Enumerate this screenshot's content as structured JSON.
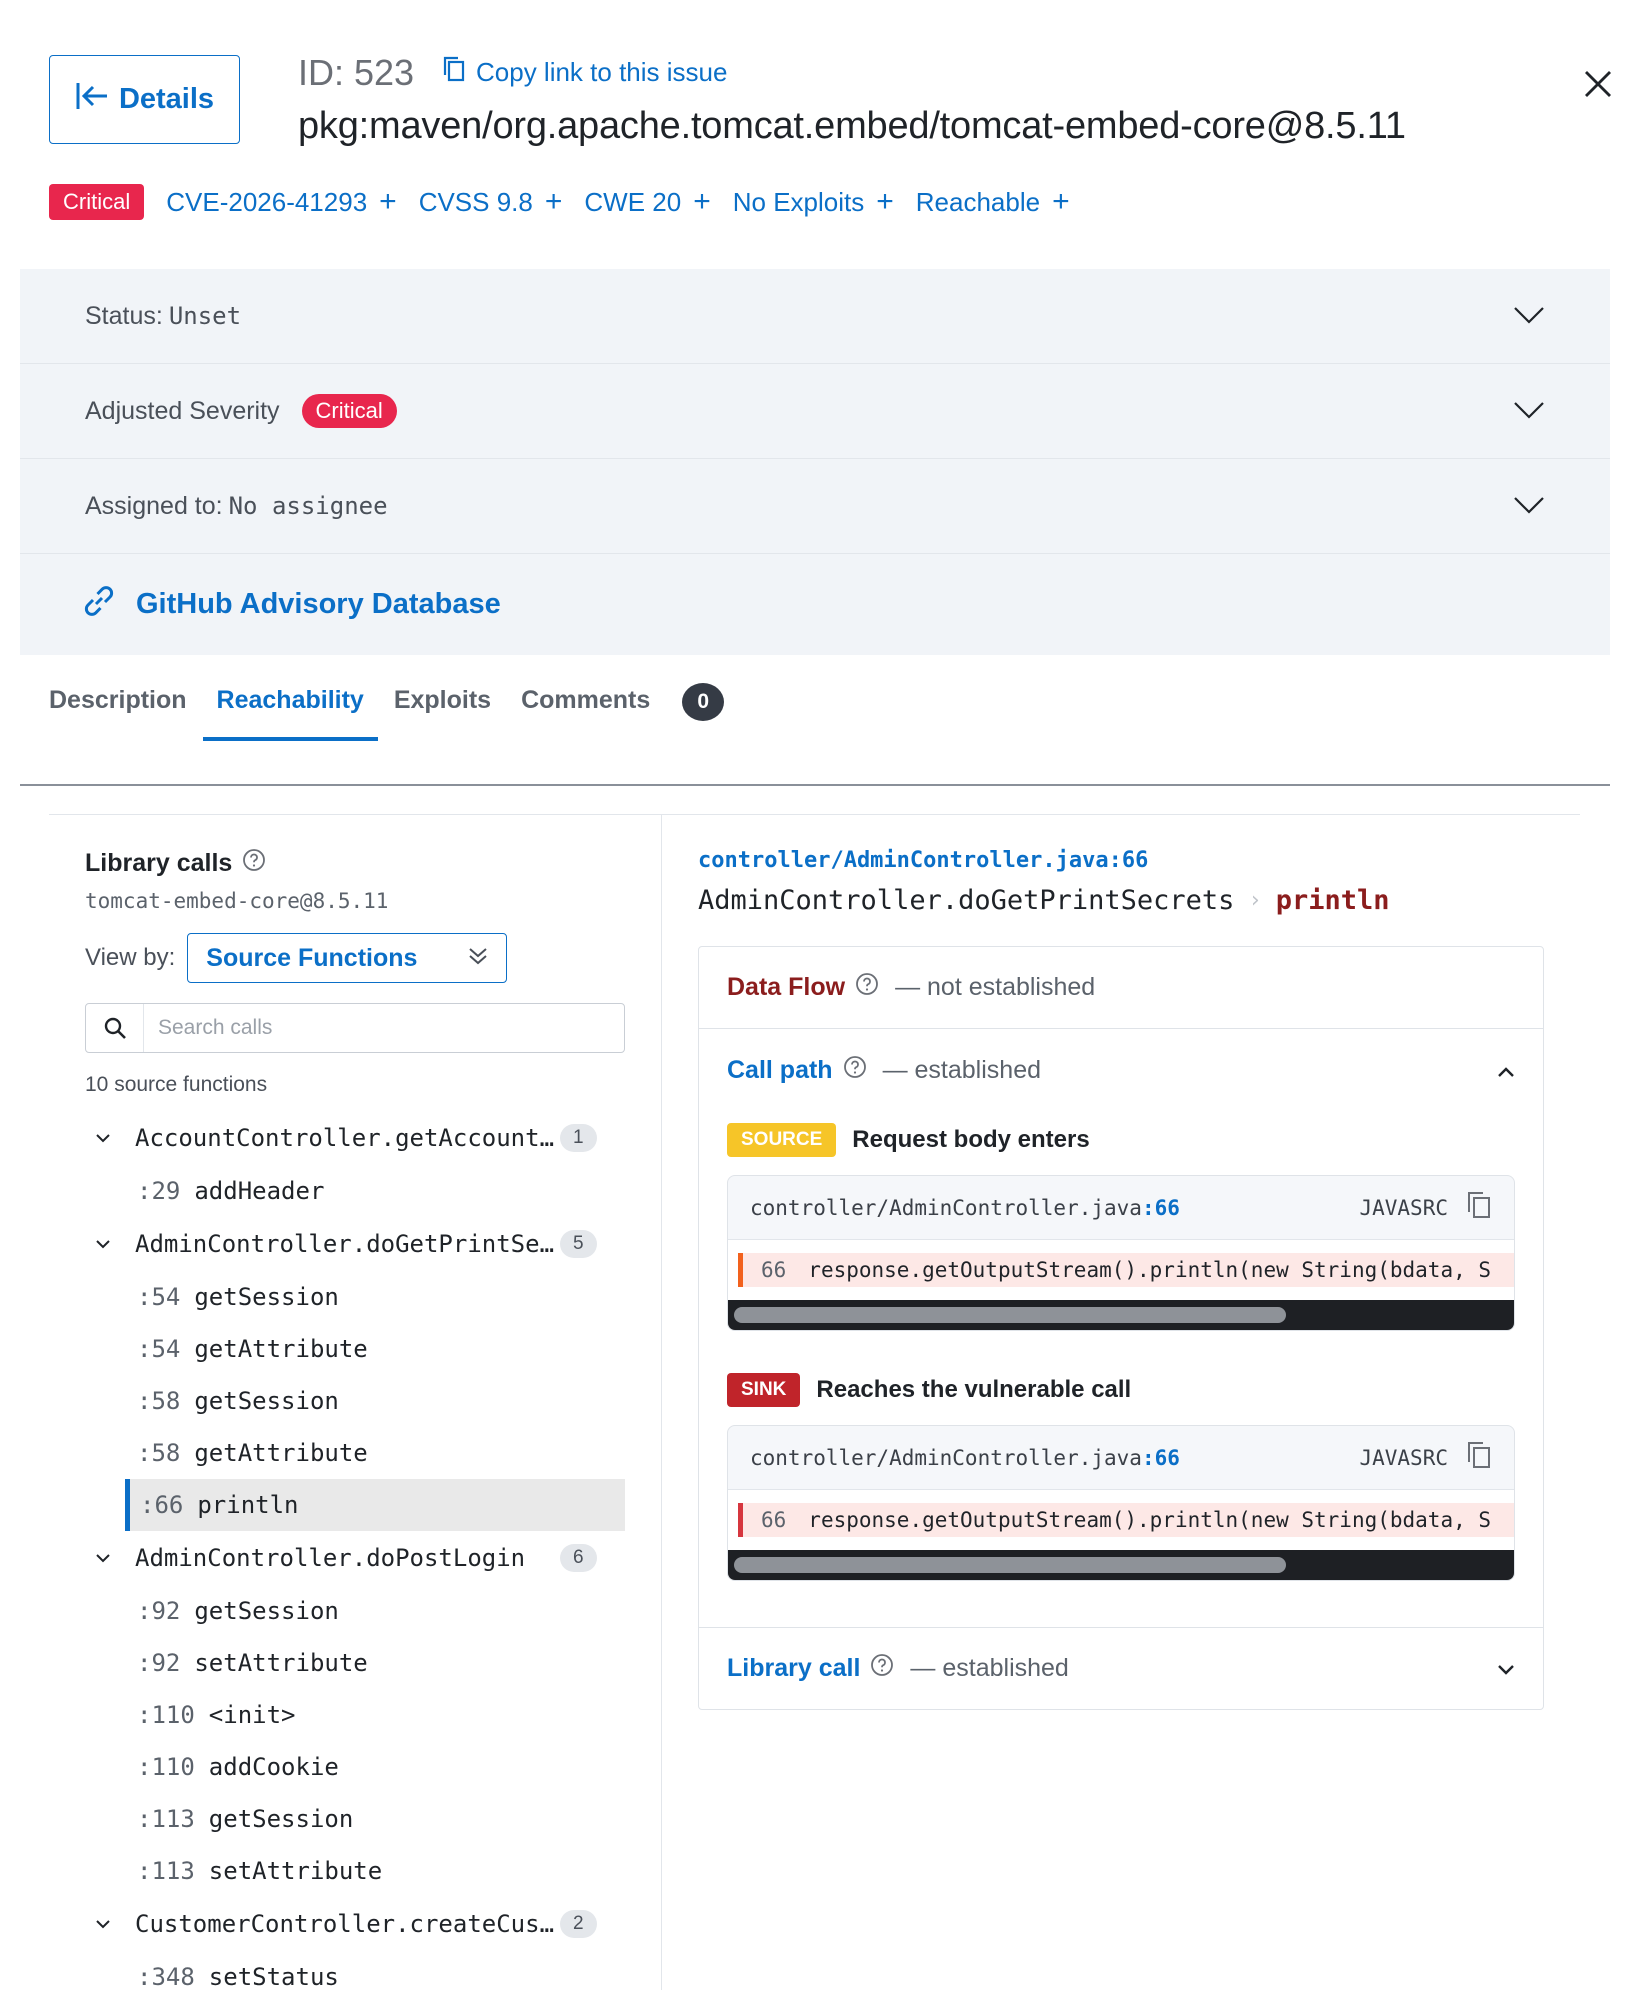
{
  "header": {
    "details_label": "Details",
    "issue_id": "ID: 523",
    "copy_link_label": "Copy link to this issue",
    "package_title": "pkg:maven/org.apache.tomcat.embed/tomcat-embed-core@8.5.11"
  },
  "tags": {
    "severity": "Critical",
    "cve": "CVE-2026-41293",
    "cvss": "CVSS 9.8",
    "cwe": "CWE 20",
    "exploits": "No Exploits",
    "reachable": "Reachable",
    "severity_color": "#e8264d"
  },
  "panel": {
    "status_label": "Status:",
    "status_value": "Unset",
    "adjusted_severity_label": "Adjusted Severity",
    "adjusted_severity_value": "Critical",
    "assigned_label": "Assigned to:",
    "assigned_value": "No assignee",
    "advisory_link": "GitHub Advisory Database"
  },
  "tabs": {
    "items": [
      "Description",
      "Reachability",
      "Exploits",
      "Comments"
    ],
    "active": "Reachability",
    "comments_count": "0"
  },
  "library": {
    "title": "Library calls",
    "subtitle": "tomcat-embed-core@8.5.11",
    "view_by_label": "View by:",
    "view_by_value": "Source Functions",
    "search_placeholder": "Search calls",
    "source_count": "10 source functions",
    "functions": [
      {
        "name": "AccountController.getAccountL…",
        "count": "1",
        "calls": [
          {
            "line": ":29",
            "name": "addHeader"
          }
        ]
      },
      {
        "name": "AdminController.doGetPrintSec…",
        "count": "5",
        "calls": [
          {
            "line": ":54",
            "name": "getSession"
          },
          {
            "line": ":54",
            "name": "getAttribute"
          },
          {
            "line": ":58",
            "name": "getSession"
          },
          {
            "line": ":58",
            "name": "getAttribute"
          },
          {
            "line": ":66",
            "name": "println"
          }
        ]
      },
      {
        "name": "AdminController.doPostLogin",
        "count": "6",
        "calls": [
          {
            "line": ":92",
            "name": "getSession"
          },
          {
            "line": ":92",
            "name": "setAttribute"
          },
          {
            "line": ":110",
            "name": "<init>"
          },
          {
            "line": ":110",
            "name": "addCookie"
          },
          {
            "line": ":113",
            "name": "getSession"
          },
          {
            "line": ":113",
            "name": "setAttribute"
          }
        ]
      },
      {
        "name": "CustomerController.createCust…",
        "count": "2",
        "calls": [
          {
            "line": ":348",
            "name": "setStatus"
          }
        ]
      }
    ]
  },
  "detail": {
    "file_link": "controller/AdminController.java:66",
    "function_path": "AdminController.doGetPrintSecrets",
    "sink_name": "println",
    "data_flow_title": "Data Flow",
    "data_flow_status": "— not established",
    "call_path_title": "Call path",
    "call_path_status": "— established",
    "source_badge": "SOURCE",
    "source_text": "Request body enters",
    "sink_badge": "SINK",
    "sink_text": "Reaches the vulnerable call",
    "code_file": "controller/AdminController.java",
    "code_line_ref": ":66",
    "code_lang": "JAVASRC",
    "code_line_number": "66",
    "code_text": "response.getOutputStream().println(new String(bdata, S",
    "library_call_title": "Library call",
    "library_call_status": "— established"
  }
}
